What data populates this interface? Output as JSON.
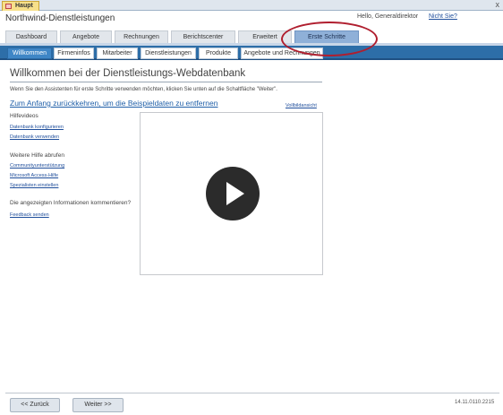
{
  "document_tab": {
    "label": "Haupt",
    "close": "x"
  },
  "header": {
    "app_title": "Northwind-Dienstleistungen",
    "greeting": "Hello, Generaldirektor",
    "not_you": "Nicht Sie?"
  },
  "top_tabs": [
    {
      "label": "Dashboard"
    },
    {
      "label": "Angebote"
    },
    {
      "label": "Rechnungen"
    },
    {
      "label": "Berichtscenter"
    },
    {
      "label": "Erweitert"
    },
    {
      "label": "Erste Schritte",
      "active": true
    }
  ],
  "sub_tabs": [
    {
      "label": "Willkommen",
      "active": true
    },
    {
      "label": "Firmeninfos"
    },
    {
      "label": "Mitarbeiter"
    },
    {
      "label": "Dienstleistungen"
    },
    {
      "label": "Produkte"
    },
    {
      "label": "Angebote und Rechnungen"
    }
  ],
  "main": {
    "heading": "Willkommen bei der Dienstleistungs-Webdatenbank",
    "intro": "Wenn Sie den Assistenten für erste Schritte verwenden möchten, klicken Sie unten auf die Schaltfläche \"Weiter\".",
    "back_link": "Zum Anfang zurückkehren, um die Beispieldaten zu entfernen",
    "fullscreen_link": "Vollbildansicht"
  },
  "sidebar": {
    "help_videos_title": "Hilfevideos",
    "help_videos": [
      "Datenbank konfigurieren",
      "Datenbank verwenden"
    ],
    "more_help_title": "Weitere Hilfe abrufen",
    "more_help": [
      "Communityunterstützung",
      "Microsoft Access-Hilfe",
      "Spezialisten einstellen"
    ],
    "feedback_title": "Die angezeigten Informationen kommentieren?",
    "feedback_link": "Feedback senden"
  },
  "footer": {
    "back_button": "<< Zurück",
    "next_button": "Weiter >>",
    "version": "14.11.0110.2215"
  },
  "colors": {
    "accent_blue": "#2d6ea8",
    "active_top_tab": "#8fb0d8",
    "highlight_ring": "#b01e2e",
    "link": "#1f4e9b"
  }
}
